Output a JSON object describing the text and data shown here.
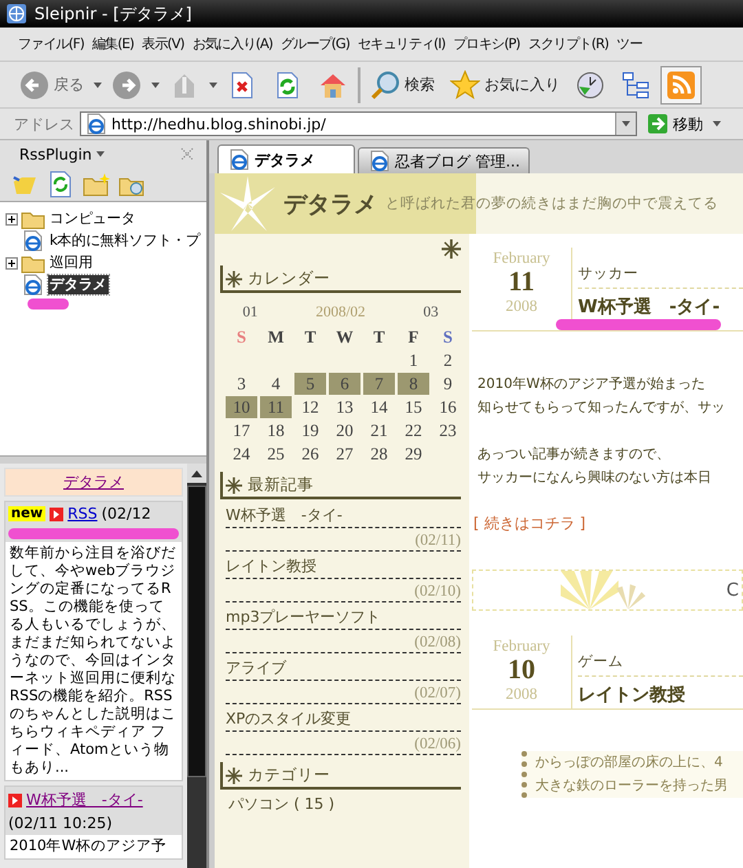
{
  "window": {
    "title": "Sleipnir - [デタラメ]"
  },
  "menu": [
    "ファイル(F)",
    "編集(E)",
    "表示(V)",
    "お気に入り(A)",
    "グループ(G)",
    "セキュリティ(I)",
    "プロキシ(P)",
    "スクリプト(R)",
    "ツー"
  ],
  "toolbar": [
    {
      "kind": "back",
      "label": "戻る",
      "dropdown": true,
      "pressed": false
    },
    {
      "kind": "forward",
      "dropdown": true,
      "pressed": false
    },
    {
      "kind": "up",
      "dropdown": true,
      "pressed": false
    },
    {
      "kind": "stop",
      "pressed": false
    },
    {
      "kind": "reload",
      "pressed": false
    },
    {
      "kind": "home",
      "pressed": false
    },
    {
      "kind": "search",
      "label": "検索",
      "pressed": false
    },
    {
      "kind": "favorites",
      "label": "お気に入り",
      "pressed": false
    },
    {
      "kind": "history",
      "pressed": false
    },
    {
      "kind": "tree",
      "pressed": false
    },
    {
      "kind": "rss",
      "pressed": true
    }
  ],
  "address": {
    "label": "アドレス",
    "value": "http://hedhu.blog.shinobi.jp/",
    "go": "移動"
  },
  "side_panel": {
    "title": "RssPlugin",
    "tree": [
      {
        "kind": "folder",
        "label": "コンピュータ",
        "expandable": true,
        "selected": false,
        "highlighted": false
      },
      {
        "kind": "page",
        "label": "k本的に無料ソフト・プ",
        "expandable": false,
        "selected": false,
        "highlighted": false
      },
      {
        "kind": "folder",
        "label": "巡回用",
        "expandable": true,
        "selected": false,
        "highlighted": false
      },
      {
        "kind": "feed",
        "label": "デタラメ",
        "expandable": false,
        "selected": true,
        "highlighted": true
      }
    ],
    "feed_title": "デタラメ",
    "entries": [
      {
        "badge": "new",
        "title": "RSS",
        "date": "(02/12",
        "highlighted": true,
        "summary": "数年前から注目を浴びだして、今やwebブラウジングの定番になってるRSS。この機能を使ってる人もいるでしょうが、まだまだ知られてないようなので、今回はインターネット巡回用に便利なRSSの機能を紹介。RSSのちゃんとした説明はこちらウィキペディア フィード、Atomという物もあり..."
      },
      {
        "title": "W杯予選　-タイ-",
        "date": "(02/11 10:25)",
        "highlighted": false,
        "summary": "2010年W杯のアジア予"
      }
    ]
  },
  "tabs": [
    {
      "label": "デタラメ",
      "selected": true
    },
    {
      "label": "忍者ブログ 管理...",
      "selected": false
    }
  ],
  "blog": {
    "title": "デタラメ",
    "tagline": "と呼ばれた君の夢の続きはまだ胸の中で震えてる",
    "calendar": {
      "heading": "カレンダー",
      "prev": "01",
      "month": "2008/02",
      "next": "03",
      "weekdays": [
        {
          "label": "S",
          "kind": "sun"
        },
        {
          "label": "M",
          "kind": "day"
        },
        {
          "label": "T",
          "kind": "day"
        },
        {
          "label": "W",
          "kind": "day"
        },
        {
          "label": "T",
          "kind": "day"
        },
        {
          "label": "F",
          "kind": "day"
        },
        {
          "label": "S",
          "kind": "sat"
        }
      ],
      "weeks": [
        [
          {
            "day": "1",
            "posted": false
          },
          {
            "day": "2",
            "posted": false
          }
        ],
        [
          {
            "day": "3",
            "posted": false
          },
          {
            "day": "4",
            "posted": false
          },
          {
            "day": "5",
            "posted": true
          },
          {
            "day": "6",
            "posted": true
          },
          {
            "day": "7",
            "posted": true
          },
          {
            "day": "8",
            "posted": true
          },
          {
            "day": "9",
            "posted": false
          }
        ],
        [
          {
            "day": "10",
            "posted": true
          },
          {
            "day": "11",
            "posted": true
          },
          {
            "day": "12",
            "posted": false
          },
          {
            "day": "13",
            "posted": false
          },
          {
            "day": "14",
            "posted": false
          },
          {
            "day": "15",
            "posted": false
          },
          {
            "day": "16",
            "posted": false
          }
        ],
        [
          {
            "day": "17",
            "posted": false
          },
          {
            "day": "18",
            "posted": false
          },
          {
            "day": "19",
            "posted": false
          },
          {
            "day": "20",
            "posted": false
          },
          {
            "day": "21",
            "posted": false
          },
          {
            "day": "22",
            "posted": false
          },
          {
            "day": "23",
            "posted": false
          }
        ],
        [
          {
            "day": "24",
            "posted": false
          },
          {
            "day": "25",
            "posted": false
          },
          {
            "day": "26",
            "posted": false
          },
          {
            "day": "27",
            "posted": false
          },
          {
            "day": "28",
            "posted": false
          },
          {
            "day": "29",
            "posted": false
          }
        ]
      ]
    },
    "recent": {
      "heading": "最新記事",
      "items": [
        {
          "title": "W杯予選　-タイ-",
          "date": "(02/11)"
        },
        {
          "title": "レイトン教授",
          "date": "(02/10)"
        },
        {
          "title": "mp3プレーヤーソフト",
          "date": "(02/08)"
        },
        {
          "title": "アライブ",
          "date": "(02/07)"
        },
        {
          "title": "XPのスタイル変更",
          "date": "(02/06)"
        }
      ]
    },
    "categories": {
      "heading": "カテゴリー",
      "items": [
        "パソコン ( 15 )"
      ]
    },
    "posts": [
      {
        "month": "February",
        "day": "11",
        "year": "2008",
        "category": "サッカー",
        "title": "W杯予選　-タイ-",
        "highlighted": true,
        "paragraphs": [
          [
            "2010年W杯のアジア予選が始まった",
            "知らせてもらって知ったんですが、サッ"
          ],
          [
            "あっつい記事が続きますので、",
            "サッカーになんら興味のない方は本日"
          ]
        ],
        "more": "[ 続きはコチラ ]",
        "footer": "C"
      },
      {
        "month": "February",
        "day": "10",
        "year": "2008",
        "category": "ゲーム",
        "title": "レイトン教授",
        "highlighted": false,
        "quote": [
          "からっぽの部屋の床の上に、4",
          "大きな鉄のローラーを持った男"
        ]
      }
    ]
  }
}
